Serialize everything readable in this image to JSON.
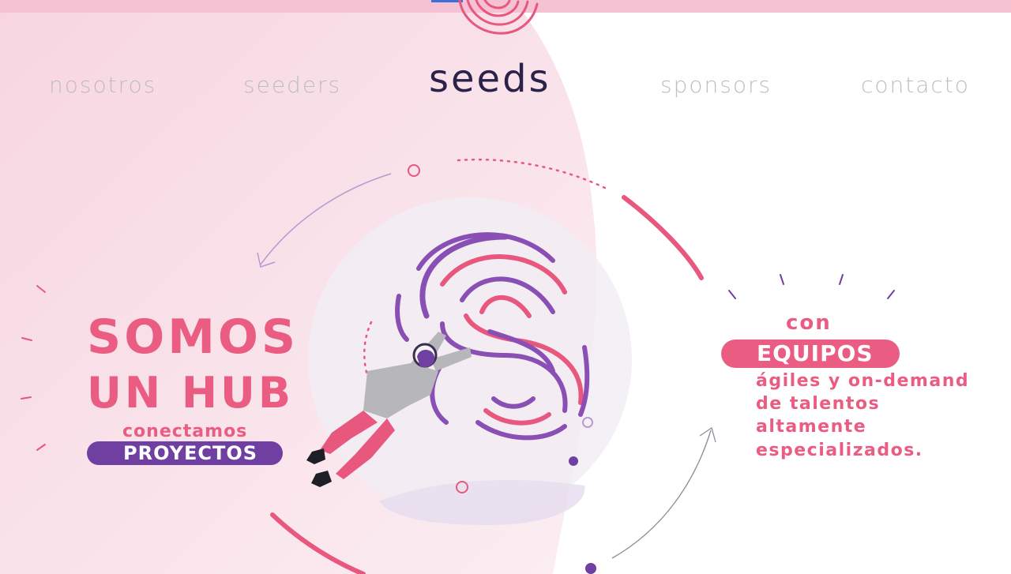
{
  "nav": {
    "nosotros": "nosotros",
    "seeders": "seeders",
    "sponsors": "sponsors",
    "contacto": "contacto"
  },
  "logo": {
    "text": "seeds"
  },
  "hero": {
    "line1": "SOMOS",
    "line2": "UN HUB",
    "connect": "conectamos",
    "projects": "PROYECTOS"
  },
  "teams": {
    "con": "con",
    "equipos": "EQUIPOS",
    "lines": [
      "ágiles y on-demand",
      "de talentos",
      "altamente",
      "especializados."
    ]
  },
  "colors": {
    "pink": "#ea5c82",
    "purple": "#6f3fa1",
    "nav_gray": "#bdbdc4",
    "logo_navy": "#2a2248",
    "top_bar": "#f4c2d3"
  },
  "icons": [
    "fingerprint-icon",
    "person-illustration",
    "arrow-icon"
  ]
}
